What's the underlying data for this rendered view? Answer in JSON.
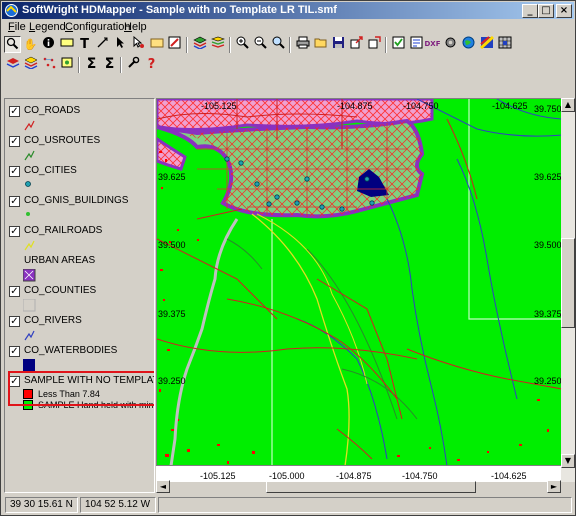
{
  "window": {
    "title": "SoftWright HDMapper - Sample with no Template LR TIL.smf",
    "controls": [
      "minimize-icon",
      "maximize-icon",
      "close-icon"
    ]
  },
  "menu": {
    "items": [
      {
        "label": "File",
        "accel": "F",
        "rest": "ile"
      },
      {
        "label": "Legend",
        "accel": "L",
        "rest": "egend"
      },
      {
        "label": "Configuration",
        "accel": "C",
        "rest": "onfiguration"
      },
      {
        "label": "Help",
        "accel": "H",
        "rest": "elp"
      }
    ]
  },
  "toolbar1": {
    "buttons": [
      "zoom-tool-icon",
      "pan-hand-icon",
      "info-icon",
      "label-icon",
      "text-tool-icon",
      "measure-line-icon",
      "select-arrow-icon",
      "select-pointer-icon",
      "fill-icon",
      "edit-layer-icon",
      "layers-icon",
      "stack-icon",
      "zoom-in-icon",
      "zoom-out-icon",
      "zoom-extent-icon",
      "print-icon",
      "open-icon",
      "save-icon",
      "export-icon",
      "copy-icon",
      "checkbox-tool-icon",
      "map-edit-icon",
      "dxf-icon",
      "gear-icon",
      "globe-icon",
      "palette-icon",
      "grid-icon"
    ],
    "dxf_label": "DXF",
    "text_tool_label": "T"
  },
  "toolbar2": {
    "buttons": [
      "layer-add-icon",
      "layer-style-icon",
      "points-icon",
      "layer-merge-icon",
      "sum-icon",
      "sum-filter-icon",
      "wrench-icon",
      "help-icon"
    ],
    "sum_label": "Σ",
    "help_label": "?"
  },
  "legend": {
    "layers": [
      {
        "name": "CO_ROADS",
        "checked": true,
        "symbol": "line",
        "color": "#d02020"
      },
      {
        "name": "CO_USROUTES",
        "checked": true,
        "symbol": "line",
        "color": "#2a8a2a"
      },
      {
        "name": "CO_CITIES",
        "checked": true,
        "symbol": "dot",
        "color": "#20a0b0"
      },
      {
        "name": "CO_GNIS_BUILDINGS",
        "checked": true,
        "symbol": "dot",
        "color": "#30c030"
      },
      {
        "name": "CO_RAILROADS",
        "checked": true,
        "symbol": "line",
        "color": "#e0e020"
      },
      {
        "name": "URBAN AREAS",
        "checked": false,
        "symbol": "fill",
        "color": "#8a30c0"
      },
      {
        "name": "CO_COUNTIES",
        "checked": true,
        "symbol": "fill",
        "color": "#d4d0c8"
      },
      {
        "name": "CO_RIVERS",
        "checked": true,
        "symbol": "line",
        "color": "#3040c0"
      },
      {
        "name": "CO_WATERBODIES",
        "checked": true,
        "symbol": "fill",
        "color": "#000080"
      },
      {
        "name": "SAMPLE WITH NO TEMPLATE LR",
        "checked": true,
        "symbol": "none",
        "color": ""
      }
    ],
    "sublegend": [
      {
        "label": "Less Than 7.84",
        "color": "#ff0000"
      },
      {
        "label": "SAMPLE Hand held with minim",
        "color": "#00ee00"
      }
    ]
  },
  "map": {
    "lat_labels": [
      "39.625",
      "39.500",
      "39.375",
      "39.250"
    ],
    "lat_right": [
      "39.750",
      "39.625",
      "39.500",
      "39.375",
      "39.250"
    ],
    "top_lon_labels": [
      "-105.125",
      "-104.875",
      "-104.750",
      "-104.625"
    ],
    "bottom_lon_labels": [
      "-105.125",
      "-105.000",
      "-104.875",
      "-104.750",
      "-104.625"
    ],
    "colors": {
      "coverage": "#00ee00",
      "low_signal": "#ff0000",
      "urban": "#8a30c0",
      "water": "#000080",
      "river": "#3040c0",
      "railroad": "#e0e020",
      "usroute": "#2a8a2a",
      "road": "#d02020"
    }
  },
  "status": {
    "latitude": "39 30 15.61 N",
    "longitude": "104 52 5.12 W"
  }
}
